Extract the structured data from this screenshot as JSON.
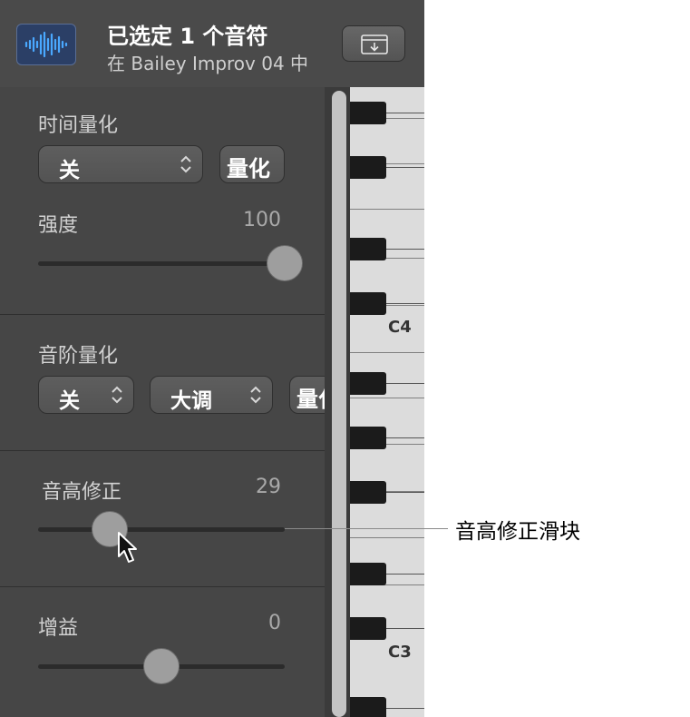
{
  "header": {
    "title": "已选定 1 个音符",
    "subtitle": "在 Bailey Improv 04 中",
    "region_icon": "waveform-icon",
    "export_icon": "tray-arrow-down-icon"
  },
  "time_quantize": {
    "label": "时间量化",
    "select_value": "关",
    "button_label": "量化",
    "strength_label": "强度",
    "strength_value": "100",
    "strength_level": 100
  },
  "scale_quantize": {
    "label": "音阶量化",
    "select1_value": "关",
    "select2_value": "大调",
    "button_label": "量化"
  },
  "pitch_correction": {
    "label": "音高修正",
    "value": "29",
    "level": 29
  },
  "gain": {
    "label": "增益",
    "value": "0",
    "level": 0
  },
  "keyboard": {
    "c4_label": "C4",
    "c3_label": "C3"
  },
  "callout": {
    "text": "音高修正滑块"
  },
  "colors": {
    "panel": "#464646",
    "header": "#4a4a4a",
    "waveform": "#4aa8ff"
  }
}
